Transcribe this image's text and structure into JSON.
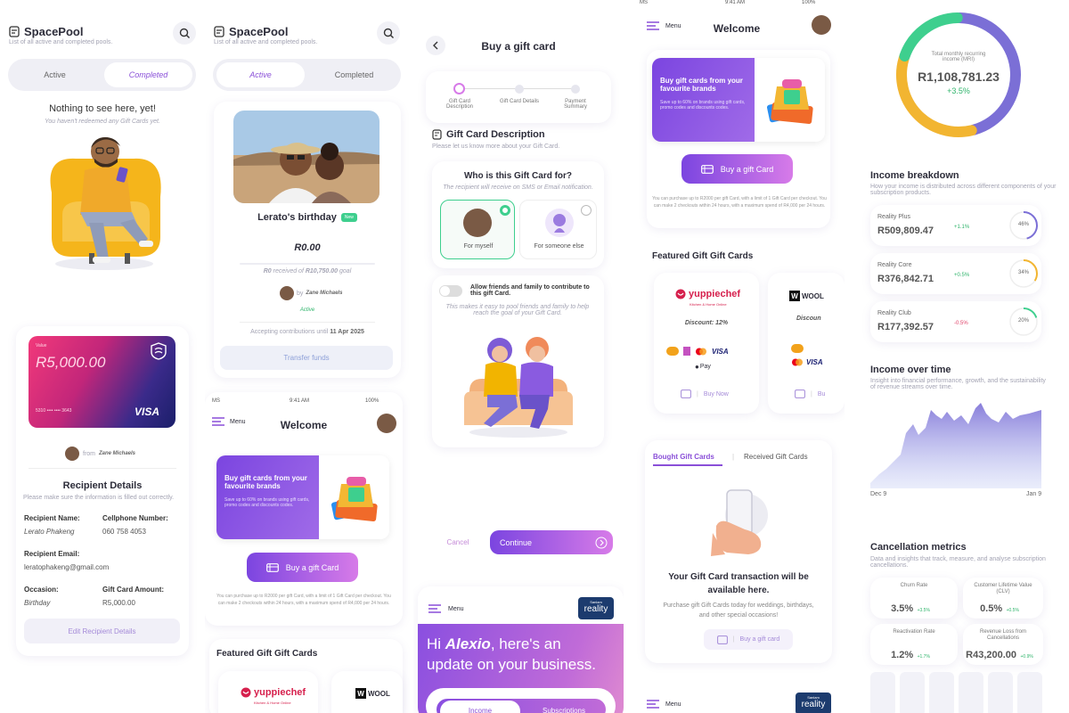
{
  "col1": {
    "app_title": "SpacePool",
    "subtitle": "List of all active and completed pools.",
    "tab_active": "Active",
    "tab_completed": "Completed",
    "empty_title": "Nothing to see here, yet!",
    "empty_sub": "You haven't redeemed any Gift Cards yet.",
    "card_value_label": "Value",
    "card_value": "R5,000.00",
    "card_number": "5310 •••• •••• 3643",
    "card_brand": "VISA",
    "from_text": "from",
    "from_name": "Zane Michaels",
    "recipient_title": "Recipient Details",
    "recipient_sub": "Please make sure the information is filled out correctly.",
    "fields": {
      "name_label": "Recipient Name:",
      "name_value": "Lerato Phakeng",
      "phone_label": "Cellphone Number:",
      "phone_value": "060 758 4053",
      "email_label": "Recipient Email:",
      "email_value": "leratophakeng@gmail.com",
      "occasion_label": "Occasion:",
      "occasion_value": "Birthday",
      "amount_label": "Gift Card Amount:",
      "amount_value": "R5,000.00"
    },
    "edit_button": "Edit Recipient Details"
  },
  "col2": {
    "app_title": "SpacePool",
    "subtitle": "List of all active and completed pools.",
    "tab_active": "Active",
    "tab_completed": "Completed",
    "pool_title": "Lerato's birthday",
    "new_badge": "New",
    "amount": "R0.00",
    "received_text_a": "R0",
    "received_text_b": "received of",
    "received_text_c": "R10,750.00",
    "received_text_d": "goal",
    "by": "by",
    "by_name": "Zane Michaels",
    "status": "Active",
    "accepting": "Accepting contributions until",
    "accepting_date": "11 Apr 2025",
    "transfer": "Transfer funds",
    "status_carrier": "MS",
    "status_time": "9:41 AM",
    "status_battery": "100%",
    "menu": "Menu",
    "welcome": "Welcome",
    "promo_title": "Buy gift cards from your favourite brands",
    "promo_sub": "Save up to 60% on brands using gift cards, promo codes and discounts codes.",
    "buy_button": "Buy a  gift Card",
    "limit_text": "You can purchase up to R2000 per gift Card, with a limit of 1 Gift Card per checkout. You can make 2 checkouts within 24 hours, with a maximum spend of R4,000 per 24 hours.",
    "featured": "Featured Gift Gift Cards",
    "brand1": "yuppiechef",
    "brand1_sub": "Kitchen & Home Online",
    "brand2": "WOOL"
  },
  "col3": {
    "title": "Buy a gift card",
    "steps": [
      "Gift Card Description",
      "Gift Card Details",
      "Payment Summary"
    ],
    "section_title": "Gift Card Description",
    "section_sub": "Please let us know more about your Gift Card.",
    "who_title": "Who is this Gift Card for?",
    "who_sub": "The recipient will receive on SMS or Email notification.",
    "opt_myself": "For myself",
    "opt_else": "For someone else",
    "toggle_title": "Allow friends and family to contribute to this gift Card.",
    "toggle_sub": "This makes it easy to pool friends and family to help reach the goal of your Gift Card.",
    "cancel": "Cancel",
    "continue": "Continue",
    "menu": "Menu",
    "reality_small": "Sanlam",
    "reality": "reality",
    "hi_line1_a": "Hi ",
    "hi_name": "Alexio",
    "hi_line1_b": ", here's an",
    "hi_line2": "update on your business.",
    "tab_income": "Income",
    "tab_subs": "Subscriptions"
  },
  "col4": {
    "status_carrier": "MS",
    "status_time": "9:41 AM",
    "status_battery": "100%",
    "menu": "Menu",
    "welcome": "Welcome",
    "promo_title": "Buy gift cards from your favourite brands",
    "promo_sub": "Save up to 60% on brands using gift cards, promo codes and discounts codes.",
    "buy_button": "Buy a  gift Card",
    "limit_text": "You can purchase up to R2000 per gift Card, with a limit of 1 Gift Card per checkout. You can make 2 checkouts within 24 hours, with a maximum spend of R4,000 per 24 hours.",
    "featured": "Featured Gift Gift Cards",
    "brand1": "yuppiechef",
    "brand1_sub": "Kitchen & Home Online",
    "discount": "Discount: 12%",
    "discount2": "Discoun",
    "brand2": "WOOL",
    "pay_visa": "VISA",
    "pay_apple": "Pay",
    "buy_now": "Buy Now",
    "bu": "Bu",
    "tab_bought": "Bought Gift Cards",
    "tab_received": "Received Gift Cards",
    "txn_title": "Your Gift Card transaction will be available here.",
    "txn_sub": "Purchase gift Gift Cards today for weddings, birthdays, and other special occasions!",
    "buy_gift": "Buy a gift card",
    "menu2": "Menu",
    "reality_small": "Sanlam",
    "reality": "reality"
  },
  "col5": {
    "donut_label": "Total monthly recurring income (MRI)",
    "donut_value": "R1,108,781.23",
    "donut_change": "+3.5%",
    "breakdown_title": "Income breakdown",
    "breakdown_sub": "How your income is distributed across different components of your subscription products.",
    "plans": [
      {
        "name": "Reality Plus",
        "value": "R509,809.47",
        "change": "+1.1%",
        "pct": "46%",
        "pct_num": 46,
        "color": "#7b6fd6"
      },
      {
        "name": "Reality Core",
        "value": "R376,842.71",
        "change": "+0.5%",
        "pct": "34%",
        "pct_num": 34,
        "color": "#f2b531"
      },
      {
        "name": "Reality Club",
        "value": "R177,392.57",
        "change": "-0.5%",
        "pct": "20%",
        "pct_num": 20,
        "color": "#3ecf8e"
      }
    ],
    "income_title": "Income over time",
    "income_sub": "Insight into financial performance, growth, and the sustainability of revenue streams over time.",
    "date_start": "Dec 9",
    "date_end": "Jan 9",
    "cancel_title": "Cancellation metrics",
    "cancel_sub": "Data and insights that track, measure, and analyse subscription cancellations.",
    "metrics": [
      {
        "label": "Churn Rate",
        "value": "3.5%",
        "change": "+3.5%"
      },
      {
        "label": "Customer Lifetime Value (CLV)",
        "value": "0.5%",
        "change": "+0.5%"
      },
      {
        "label": "Reactivation Rate",
        "value": "1.2%",
        "change": "+1.7%"
      },
      {
        "label": "Revenue Loss from Cancellations",
        "value": "R43,200.00",
        "change": "+0.9%"
      }
    ]
  },
  "colors": {
    "accent": "#8a4fd8",
    "accent2": "#d77be8",
    "green": "#2fb46b"
  }
}
